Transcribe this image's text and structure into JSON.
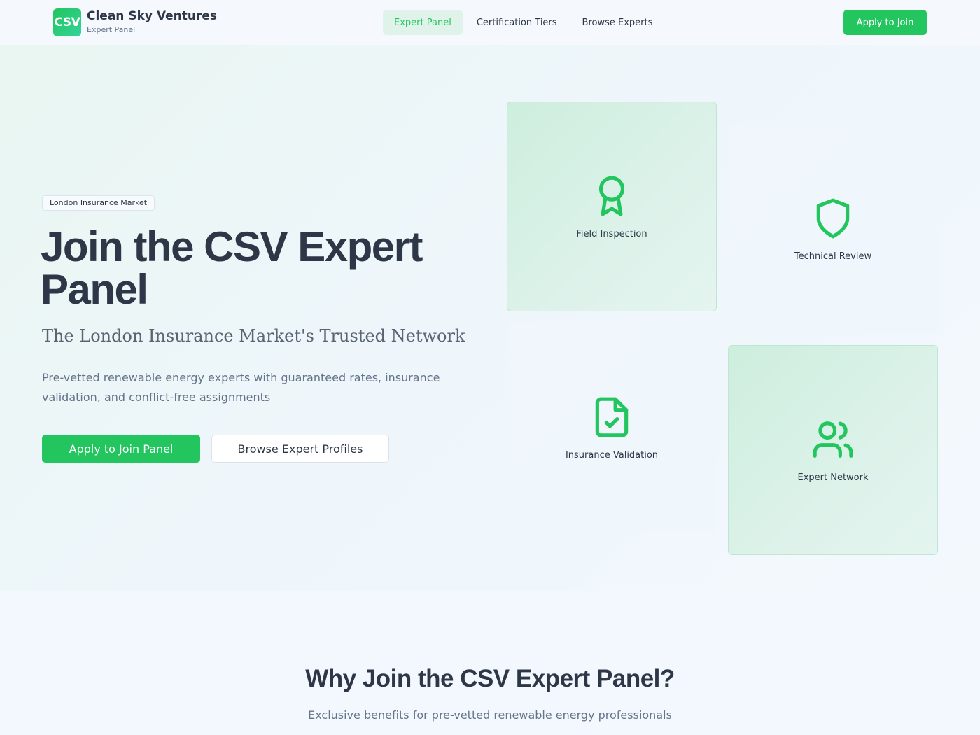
{
  "header": {
    "logo_text": "CSV",
    "brand_name": "Clean Sky Ventures",
    "brand_sub": "Expert Panel",
    "nav": [
      {
        "label": "Expert Panel",
        "active": true
      },
      {
        "label": "Certification Tiers",
        "active": false
      },
      {
        "label": "Browse Experts",
        "active": false
      }
    ],
    "cta_label": "Apply to Join"
  },
  "hero": {
    "badge": "London Insurance Market",
    "title": "Join the CSV Expert Panel",
    "subtitle": "The London Insurance Market's Trusted Network",
    "description": "Pre-vetted renewable energy experts with guaranteed rates, insurance validation, and conflict-free assignments",
    "primary_button": "Apply to Join Panel",
    "secondary_button": "Browse Expert Profiles"
  },
  "cards": [
    {
      "label": "Field Inspection",
      "icon": "award-ribbon-icon"
    },
    {
      "label": "Technical Review",
      "icon": "shield-icon"
    },
    {
      "label": "Insurance Validation",
      "icon": "file-check-icon"
    },
    {
      "label": "Expert Network",
      "icon": "users-icon"
    }
  ],
  "why": {
    "title": "Why Join the CSV Expert Panel?",
    "subtitle": "Exclusive benefits for pre-vetted renewable energy professionals"
  },
  "colors": {
    "accent": "#22c55e",
    "text": "#2d3748",
    "muted": "#64748b",
    "card_highlight": "#d6f1e3"
  }
}
